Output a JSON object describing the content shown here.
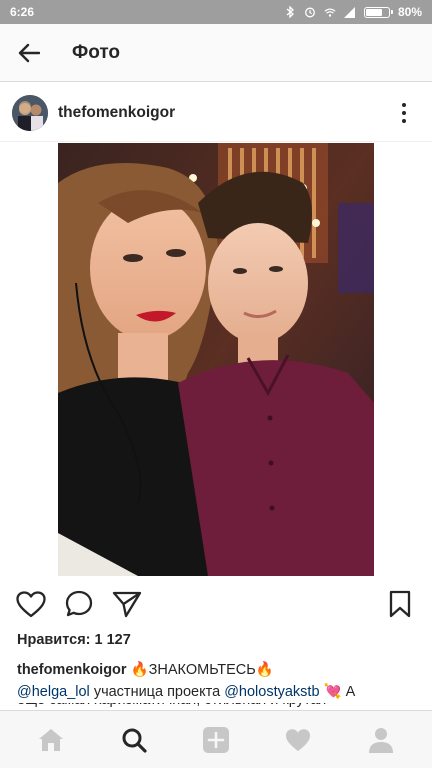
{
  "status_bar": {
    "time": "6:26",
    "battery_percent": "80%",
    "battery_level": 0.8,
    "icons": [
      "bluetooth-icon",
      "alarm-icon",
      "wifi-icon",
      "signal-icon",
      "battery-icon"
    ]
  },
  "app_bar": {
    "title": "Фото",
    "back_icon": "arrow-left-icon"
  },
  "post": {
    "username": "thefomenkoigor",
    "likes_label": "Нравится: 1 127",
    "caption": {
      "user": "thefomenkoigor",
      "fire_emoji": "🔥",
      "headline": "ЗНАКОМЬТЕСЬ",
      "mention_1": "@helga_lol",
      "text_1": "участница проекта",
      "mention_2": "@holostyakstb",
      "heart_emoji": "💘",
      "text_2": "А",
      "clipped_line": "ещё самая харизматичная, стильная и крутая"
    },
    "actions": [
      "heart-icon",
      "comment-icon",
      "share-icon",
      "bookmark-icon"
    ]
  },
  "bottom_nav": [
    "home-icon",
    "search-icon",
    "add-icon",
    "activity-icon",
    "profile-icon"
  ]
}
